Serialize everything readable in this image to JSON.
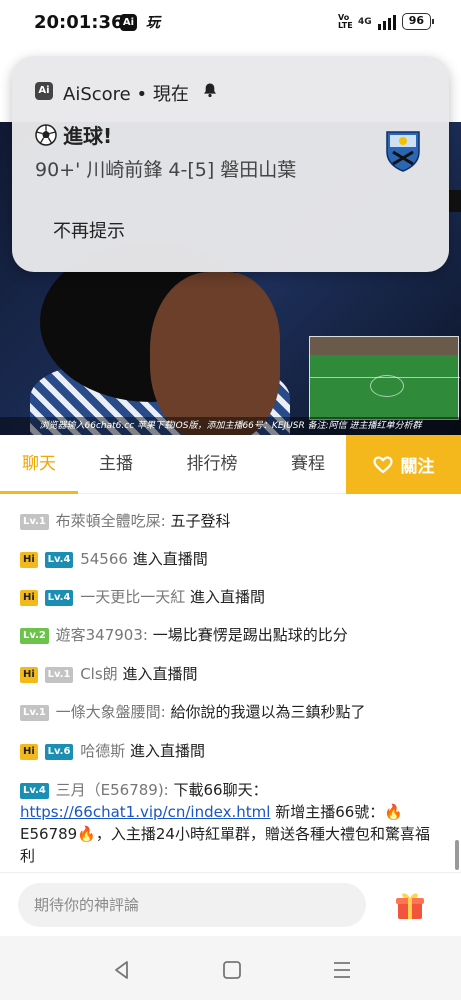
{
  "status_bar": {
    "time": "20:01:36",
    "app_icon_1": "Ai",
    "app_icon_2": "玩",
    "volte": "Vo LTE",
    "network": "4G",
    "battery": "96"
  },
  "notification": {
    "app_icon": "Ai",
    "app_name": "AiScore",
    "separator": "•",
    "time": "現在",
    "title": "進球!",
    "body": "90+' 川崎前鋒 4-[5] 磐田山葉",
    "action": "不再提示",
    "icons": [
      "bell-icon",
      "soccer-ball-icon",
      "team-crest-logo"
    ]
  },
  "video": {
    "marquee": "浏览器输入66chat6.cc 苹果下载IOS版，添加主播66号：KEJUSR 备注:阿信 进主播红单分析群"
  },
  "tabs": [
    {
      "label": "聊天",
      "active": true
    },
    {
      "label": "主播",
      "active": false
    },
    {
      "label": "排行榜",
      "active": false
    },
    {
      "label": "賽程",
      "active": false
    }
  ],
  "follow": {
    "label": "關注",
    "icon": "heart-icon"
  },
  "chat": [
    {
      "badges": [
        "Lv.1"
      ],
      "badge_colors": [
        "gray"
      ],
      "user": "布萊頓全體吃屎:",
      "text": "五子登科"
    },
    {
      "badges": [
        "Hi",
        "Lv.4"
      ],
      "badge_colors": [
        "hi",
        "blue"
      ],
      "user": "54566",
      "text": "進入直播間"
    },
    {
      "badges": [
        "Hi",
        "Lv.4"
      ],
      "badge_colors": [
        "hi",
        "blue"
      ],
      "user": "一天更比一天紅",
      "text": "進入直播間"
    },
    {
      "badges": [
        "Lv.2"
      ],
      "badge_colors": [
        "green"
      ],
      "user": "遊客347903:",
      "text": "一場比賽愣是踢出點球的比分"
    },
    {
      "badges": [
        "Hi",
        "Lv.1"
      ],
      "badge_colors": [
        "hi",
        "gray"
      ],
      "user": "Cls朗",
      "text": "進入直播間"
    },
    {
      "badges": [
        "Lv.1"
      ],
      "badge_colors": [
        "gray"
      ],
      "user": "一條大象盤腰間:",
      "text": "給你說的我還以為三鎮秒點了"
    },
    {
      "badges": [
        "Hi",
        "Lv.6"
      ],
      "badge_colors": [
        "hi",
        "blue"
      ],
      "user": "哈德斯",
      "text": "進入直播間"
    },
    {
      "badges": [
        "Lv.4"
      ],
      "badge_colors": [
        "blue"
      ],
      "user": "三月（E56789):",
      "text_before": "下載66聊天：",
      "link": "https://66chat1.vip/cn/index.html",
      "text_after_1": "新增主播66號：🔥",
      "text_after_2": "E56789🔥，入主播24小時紅單群，贈送各種大禮包和驚喜福利"
    }
  ],
  "input": {
    "placeholder": "期待你的神評論",
    "icon": "gift-icon"
  },
  "nav": {
    "icons": [
      "back-icon",
      "home-icon",
      "menu-icon"
    ]
  },
  "colors": {
    "accent": "#f5b81c",
    "link": "#1a56c8",
    "level_blue": "#1b8fb3",
    "level_green": "#6cc24a",
    "level_gray": "#c3c3c3"
  }
}
